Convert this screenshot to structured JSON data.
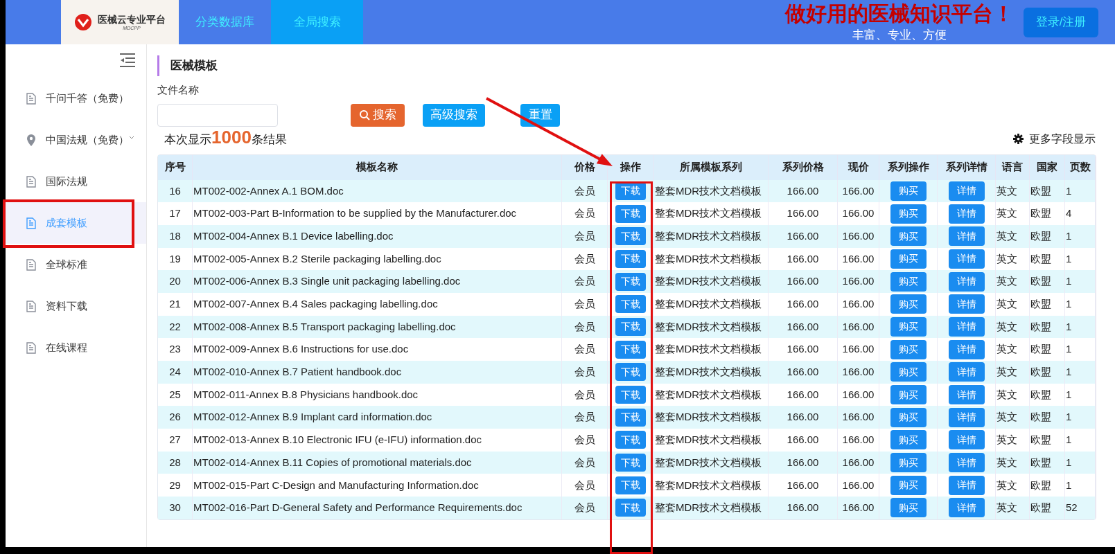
{
  "header": {
    "logo_title": "医械云专业平台",
    "logo_subtitle": "MDCPP",
    "nav": [
      {
        "label": "分类数据库",
        "selected": false
      },
      {
        "label": "全局搜索",
        "selected": true
      }
    ],
    "slogan": "做好用的医械知识平台！",
    "tagline": "丰富、专业、方便",
    "login_button": "登录/注册"
  },
  "sidebar": {
    "items": [
      {
        "label": "千问千答（免费）",
        "kind": "doc",
        "selected": false,
        "has_submenu": false
      },
      {
        "label": "中国法规（免费）",
        "kind": "pin",
        "selected": false,
        "has_submenu": true
      },
      {
        "label": "国际法规",
        "kind": "doc",
        "selected": false,
        "has_submenu": false
      },
      {
        "label": "成套模板",
        "kind": "doc",
        "selected": true,
        "has_submenu": false
      },
      {
        "label": "全球标准",
        "kind": "doc",
        "selected": false,
        "has_submenu": false
      },
      {
        "label": "资料下载",
        "kind": "doc",
        "selected": false,
        "has_submenu": false
      },
      {
        "label": "在线课程",
        "kind": "doc",
        "selected": false,
        "has_submenu": false
      }
    ]
  },
  "page_title": "医械模板",
  "filter": {
    "label": "文件名称",
    "search_button": "搜索",
    "advanced_button": "高级搜索",
    "reset_button": "重置"
  },
  "result": {
    "prefix": "本次显示",
    "count": "1000",
    "suffix": "条结果",
    "more_fields": "更多字段显示"
  },
  "table": {
    "columns": [
      "序号",
      "模板名称",
      "价格",
      "操作",
      "所属模板系列",
      "系列价格",
      "现价",
      "系列操作",
      "系列详情",
      "语言",
      "国家",
      "页数"
    ],
    "rows": [
      [
        "16",
        "MT002-002-Annex A.1 BOM.doc",
        "会员",
        "下载",
        "整套MDR技术文档模板",
        "166.00",
        "166.00",
        "购买",
        "详情",
        "英文",
        "欧盟",
        "1"
      ],
      [
        "17",
        "MT002-003-Part B-Information to be supplied by the Manufacturer.doc",
        "会员",
        "下载",
        "整套MDR技术文档模板",
        "166.00",
        "166.00",
        "购买",
        "详情",
        "英文",
        "欧盟",
        "4"
      ],
      [
        "18",
        "MT002-004-Annex B.1 Device labelling.doc",
        "会员",
        "下载",
        "整套MDR技术文档模板",
        "166.00",
        "166.00",
        "购买",
        "详情",
        "英文",
        "欧盟",
        "1"
      ],
      [
        "19",
        "MT002-005-Annex B.2 Sterile packaging labelling.doc",
        "会员",
        "下载",
        "整套MDR技术文档模板",
        "166.00",
        "166.00",
        "购买",
        "详情",
        "英文",
        "欧盟",
        "1"
      ],
      [
        "20",
        "MT002-006-Annex B.3 Single unit packaging labelling.doc",
        "会员",
        "下载",
        "整套MDR技术文档模板",
        "166.00",
        "166.00",
        "购买",
        "详情",
        "英文",
        "欧盟",
        "1"
      ],
      [
        "21",
        "MT002-007-Annex B.4 Sales packaging labelling.doc",
        "会员",
        "下载",
        "整套MDR技术文档模板",
        "166.00",
        "166.00",
        "购买",
        "详情",
        "英文",
        "欧盟",
        "1"
      ],
      [
        "22",
        "MT002-008-Annex B.5 Transport packaging labelling.doc",
        "会员",
        "下载",
        "整套MDR技术文档模板",
        "166.00",
        "166.00",
        "购买",
        "详情",
        "英文",
        "欧盟",
        "1"
      ],
      [
        "23",
        "MT002-009-Annex B.6 Instructions for use.doc",
        "会员",
        "下载",
        "整套MDR技术文档模板",
        "166.00",
        "166.00",
        "购买",
        "详情",
        "英文",
        "欧盟",
        "1"
      ],
      [
        "24",
        "MT002-010-Annex B.7 Patient handbook.doc",
        "会员",
        "下载",
        "整套MDR技术文档模板",
        "166.00",
        "166.00",
        "购买",
        "详情",
        "英文",
        "欧盟",
        "1"
      ],
      [
        "25",
        "MT002-011-Annex B.8 Physicians handbook.doc",
        "会员",
        "下载",
        "整套MDR技术文档模板",
        "166.00",
        "166.00",
        "购买",
        "详情",
        "英文",
        "欧盟",
        "1"
      ],
      [
        "26",
        "MT002-012-Annex B.9 Implant card information.doc",
        "会员",
        "下载",
        "整套MDR技术文档模板",
        "166.00",
        "166.00",
        "购买",
        "详情",
        "英文",
        "欧盟",
        "1"
      ],
      [
        "27",
        "MT002-013-Annex B.10 Electronic IFU (e-IFU) information.doc",
        "会员",
        "下载",
        "整套MDR技术文档模板",
        "166.00",
        "166.00",
        "购买",
        "详情",
        "英文",
        "欧盟",
        "1"
      ],
      [
        "28",
        "MT002-014-Annex B.11 Copies of promotional materials.doc",
        "会员",
        "下载",
        "整套MDR技术文档模板",
        "166.00",
        "166.00",
        "购买",
        "详情",
        "英文",
        "欧盟",
        "1"
      ],
      [
        "29",
        "MT002-015-Part C-Design and Manufacturing Information.doc",
        "会员",
        "下载",
        "整套MDR技术文档模板",
        "166.00",
        "166.00",
        "购买",
        "详情",
        "英文",
        "欧盟",
        "1"
      ],
      [
        "30",
        "MT002-016-Part D-General Safety and Performance Requirements.doc",
        "会员",
        "下载",
        "整套MDR技术文档模板",
        "166.00",
        "166.00",
        "购买",
        "详情",
        "英文",
        "欧盟",
        "52"
      ]
    ]
  }
}
